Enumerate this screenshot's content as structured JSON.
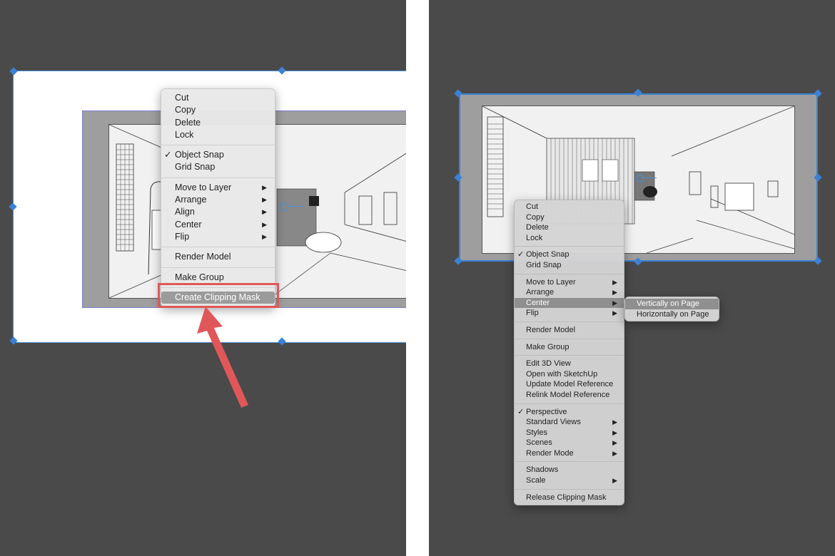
{
  "left_panel": {
    "context_menu": {
      "items": [
        {
          "label": "Cut",
          "checked": false,
          "submenu": false
        },
        {
          "label": "Copy",
          "checked": false,
          "submenu": false
        },
        {
          "label": "Delete",
          "checked": false,
          "submenu": false
        },
        {
          "label": "Lock",
          "checked": false,
          "submenu": false
        },
        {
          "separator": true
        },
        {
          "label": "Object Snap",
          "checked": true,
          "submenu": false
        },
        {
          "label": "Grid Snap",
          "checked": false,
          "submenu": false
        },
        {
          "separator": true
        },
        {
          "label": "Move to Layer",
          "checked": false,
          "submenu": true
        },
        {
          "label": "Arrange",
          "checked": false,
          "submenu": true
        },
        {
          "label": "Align",
          "checked": false,
          "submenu": true
        },
        {
          "label": "Center",
          "checked": false,
          "submenu": true
        },
        {
          "label": "Flip",
          "checked": false,
          "submenu": true
        },
        {
          "separator": true
        },
        {
          "label": "Render Model",
          "checked": false,
          "submenu": false
        },
        {
          "separator": true
        },
        {
          "label": "Make Group",
          "checked": false,
          "submenu": false
        },
        {
          "separator": true
        },
        {
          "label": "Create Clipping Mask",
          "checked": false,
          "submenu": false,
          "highlighted": true
        }
      ]
    },
    "annotation": {
      "color": "#e0575a",
      "target": "Create Clipping Mask"
    }
  },
  "right_panel": {
    "context_menu": {
      "items": [
        {
          "label": "Cut",
          "checked": false,
          "submenu": false
        },
        {
          "label": "Copy",
          "checked": false,
          "submenu": false
        },
        {
          "label": "Delete",
          "checked": false,
          "submenu": false
        },
        {
          "label": "Lock",
          "checked": false,
          "submenu": false
        },
        {
          "separator": true
        },
        {
          "label": "Object Snap",
          "checked": true,
          "submenu": false
        },
        {
          "label": "Grid Snap",
          "checked": false,
          "submenu": false
        },
        {
          "separator": true
        },
        {
          "label": "Move to Layer",
          "checked": false,
          "submenu": true
        },
        {
          "label": "Arrange",
          "checked": false,
          "submenu": true
        },
        {
          "label": "Center",
          "checked": false,
          "submenu": true,
          "active": true
        },
        {
          "label": "Flip",
          "checked": false,
          "submenu": true
        },
        {
          "separator": true
        },
        {
          "label": "Render Model",
          "checked": false,
          "submenu": false
        },
        {
          "separator": true
        },
        {
          "label": "Make Group",
          "checked": false,
          "submenu": false
        },
        {
          "separator": true
        },
        {
          "label": "Edit 3D View",
          "checked": false,
          "submenu": false
        },
        {
          "label": "Open with SketchUp",
          "checked": false,
          "submenu": false
        },
        {
          "label": "Update Model Reference",
          "checked": false,
          "submenu": false
        },
        {
          "label": "Relink Model Reference",
          "checked": false,
          "submenu": false
        },
        {
          "separator": true
        },
        {
          "label": "Perspective",
          "checked": true,
          "submenu": false
        },
        {
          "label": "Standard Views",
          "checked": false,
          "submenu": true
        },
        {
          "label": "Styles",
          "checked": false,
          "submenu": true
        },
        {
          "label": "Scenes",
          "checked": false,
          "submenu": true
        },
        {
          "label": "Render Mode",
          "checked": false,
          "submenu": true
        },
        {
          "separator": true
        },
        {
          "label": "Shadows",
          "checked": false,
          "submenu": false
        },
        {
          "label": "Scale",
          "checked": false,
          "submenu": true
        },
        {
          "separator": true
        },
        {
          "label": "Release Clipping Mask",
          "checked": false,
          "submenu": false
        }
      ]
    },
    "center_submenu": {
      "items": [
        {
          "label": "Vertically on Page",
          "highlighted": true
        },
        {
          "label": "Horizontally on Page",
          "highlighted": false
        }
      ]
    }
  },
  "glyphs": {
    "check": "✓",
    "submenu_arrow": "▶"
  },
  "colors": {
    "canvas_bg": "#4a4a4a",
    "selection": "#3b82d6",
    "viewport_frame": "#9e9e9e",
    "annotation": "#e0575a"
  }
}
